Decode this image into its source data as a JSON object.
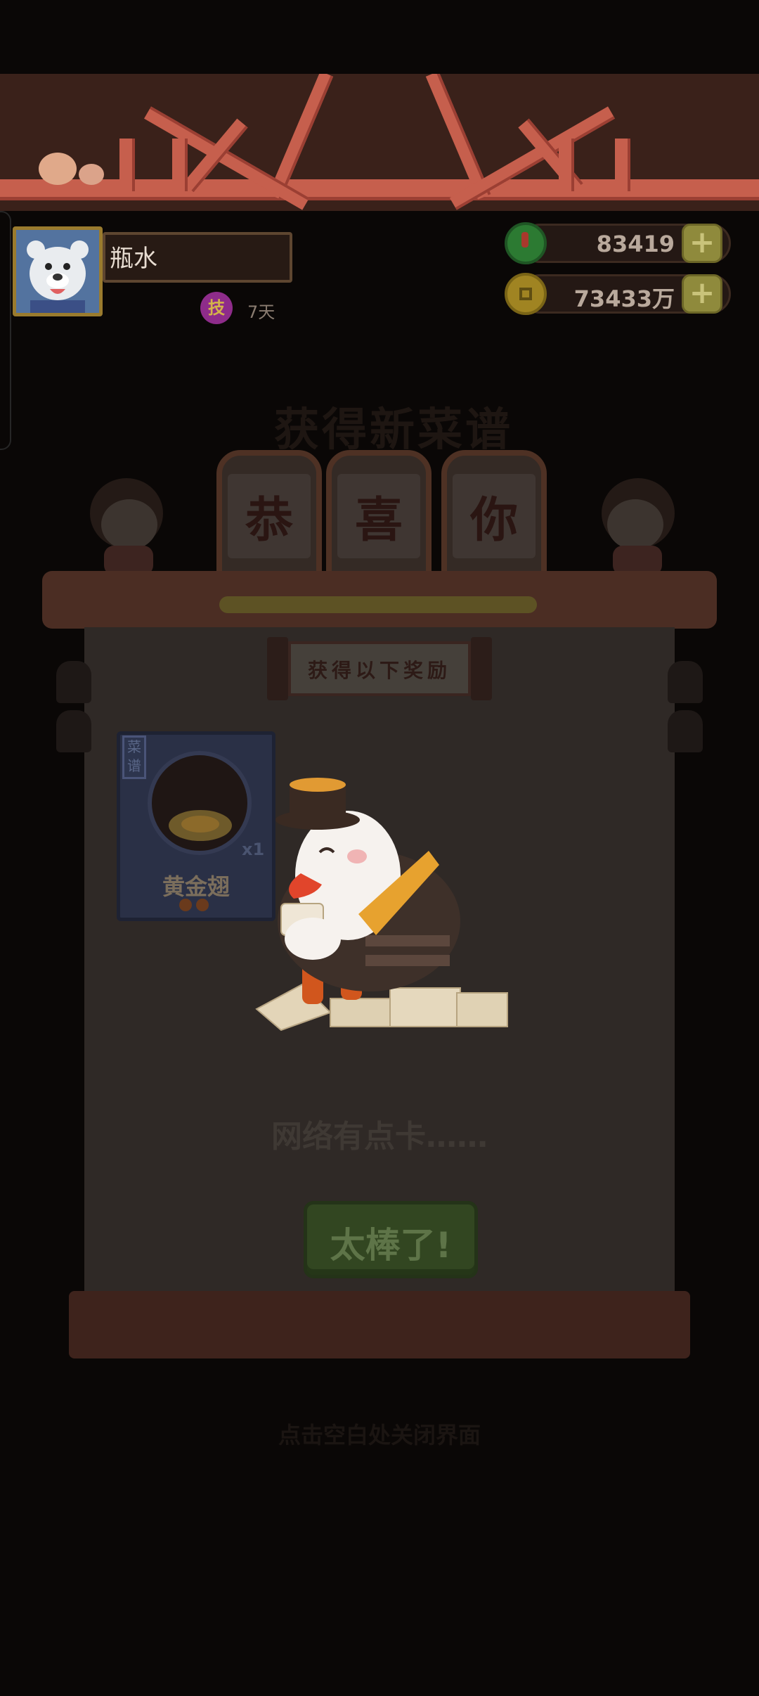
{
  "player": {
    "name": "瓶水",
    "vip_badge": "技",
    "vip_days": "7天"
  },
  "resources": {
    "jade": {
      "value": "83419",
      "icon": "jade-icon"
    },
    "coins": {
      "value": "73433万",
      "icon": "coin-icon"
    },
    "plus_label": "+"
  },
  "reward_popup": {
    "faded_title": "获得新菜谱",
    "sign_chars": [
      "恭",
      "喜",
      "你"
    ],
    "subtitle": "获得以下奖励",
    "item": {
      "tag": "菜谱",
      "name": "黄金翅",
      "quantity": "x1",
      "icon": "dish-icon"
    },
    "network_message": "网络有点卡……",
    "confirm_button": "太棒了!",
    "close_hint": "点击空白处关闭界面"
  },
  "colors": {
    "background": "#0a0706",
    "panel": "#2f2926",
    "button": "#324621",
    "roof": "#c65f4d"
  }
}
